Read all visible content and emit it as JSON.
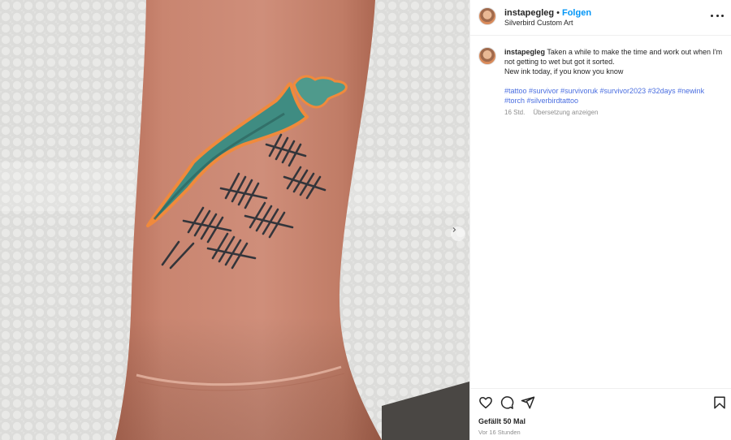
{
  "post": {
    "username": "instapegleg",
    "follow_label": "Folgen",
    "separator": "•",
    "location": "Silverbird Custom Art",
    "caption_line1": "Taken a while to make the time and work out when I'm not getting to wet but got it sorted.",
    "caption_line2": "New ink today, if you know you know",
    "hashtags": "#tattoo #survivor #survivoruk #survivor2023 #32days #newink #torch #silverbirdtattoo",
    "comment_time": "16 Std.",
    "translate_label": "Übersetzung anzeigen",
    "likes": "Gefällt 50 Mal",
    "posted_ago": "Vor 16 Stunden"
  },
  "icons": {
    "more": "more-options-icon",
    "next": "chevron-right-icon",
    "like": "heart-icon",
    "comment": "comment-icon",
    "share": "share-icon",
    "save": "bookmark-icon"
  },
  "colors": {
    "follow": "#0095f6",
    "hashtag": "#4a6ee0",
    "muted": "#8e8e8e",
    "text": "#262626"
  }
}
